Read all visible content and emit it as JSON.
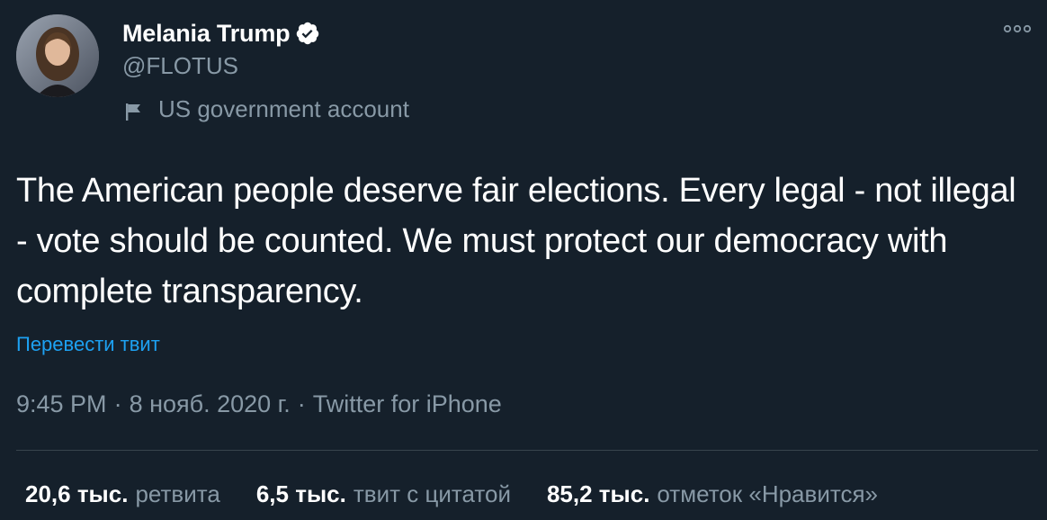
{
  "user": {
    "display_name": "Melania Trump",
    "handle": "@FLOTUS",
    "account_label": "US government account",
    "verified": true
  },
  "tweet": {
    "text": "The American people deserve fair elections. Every legal - not illegal - vote should be counted. We must protect our democracy with complete transparency.",
    "translate_label": "Перевести твит",
    "time": "9:45 PM",
    "date": "8 нояб. 2020 г.",
    "source": "Twitter for iPhone",
    "separator": "·"
  },
  "stats": [
    {
      "count": "20,6 тыс.",
      "label": "ретвита"
    },
    {
      "count": "6,5 тыс.",
      "label": "твит с цитатой"
    },
    {
      "count": "85,2 тыс.",
      "label": "отметок «Нравится»"
    }
  ],
  "colors": {
    "background": "#15202b",
    "text": "#ffffff",
    "secondary_text": "#8899a6",
    "accent": "#1da1f2",
    "divider": "#38444d"
  },
  "icons": {
    "verified": "verified-badge-icon",
    "more": "more-options-icon",
    "government_flag": "flag-icon"
  }
}
